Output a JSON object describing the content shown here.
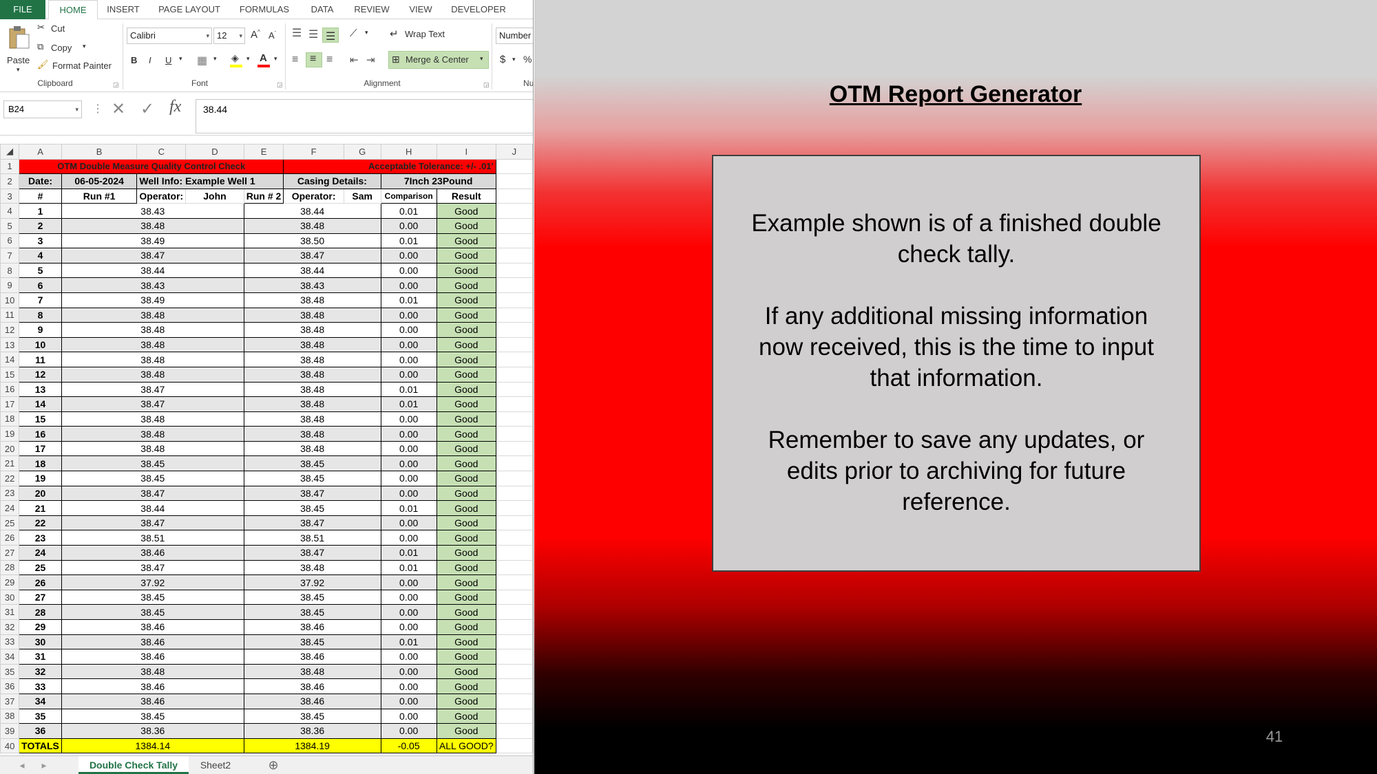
{
  "excel": {
    "ribbon_tabs": [
      "FILE",
      "HOME",
      "INSERT",
      "PAGE LAYOUT",
      "FORMULAS",
      "DATA",
      "REVIEW",
      "VIEW",
      "DEVELOPER"
    ],
    "clipboard": {
      "paste": "Paste",
      "cut": "Cut",
      "copy": "Copy",
      "format_painter": "Format Painter",
      "label": "Clipboard"
    },
    "font": {
      "name": "Calibri",
      "size": "12",
      "label": "Font",
      "bold": "B",
      "italic": "I",
      "underline": "U"
    },
    "alignment": {
      "wrap_text": "Wrap Text",
      "merge_center": "Merge & Center",
      "label": "Alignment"
    },
    "number": {
      "format": "Number",
      "label": "Nu",
      "currency": "$",
      "percent": "%"
    },
    "name_box": "B24",
    "formula_value": "38.44",
    "columns": [
      "A",
      "B",
      "C",
      "D",
      "E",
      "F",
      "G",
      "H",
      "I",
      "J"
    ],
    "row1": {
      "title": "OTM Double Measure Quality Control Check",
      "tolerance": "Acceptable Tolerance: +/- .01'"
    },
    "row2": {
      "date_label": "Date:",
      "date_value": "06-05-2024",
      "well_info": "Well Info: Example Well 1",
      "casing_label": "Casing Details:",
      "casing_value": "7Inch 23Pound"
    },
    "row3": {
      "num": "#",
      "run1": "Run #1",
      "operator1_label": "Operator:",
      "operator1": "John",
      "run2": "Run # 2",
      "operator2_label": "Operator:",
      "operator2": "Sam",
      "comparison": "Comparison",
      "result": "Result"
    },
    "rows": [
      [
        "1",
        "38.43",
        "38.44",
        "0.01",
        "Good"
      ],
      [
        "2",
        "38.48",
        "38.48",
        "0.00",
        "Good"
      ],
      [
        "3",
        "38.49",
        "38.50",
        "0.01",
        "Good"
      ],
      [
        "4",
        "38.47",
        "38.47",
        "0.00",
        "Good"
      ],
      [
        "5",
        "38.44",
        "38.44",
        "0.00",
        "Good"
      ],
      [
        "6",
        "38.43",
        "38.43",
        "0.00",
        "Good"
      ],
      [
        "7",
        "38.49",
        "38.48",
        "0.01",
        "Good"
      ],
      [
        "8",
        "38.48",
        "38.48",
        "0.00",
        "Good"
      ],
      [
        "9",
        "38.48",
        "38.48",
        "0.00",
        "Good"
      ],
      [
        "10",
        "38.48",
        "38.48",
        "0.00",
        "Good"
      ],
      [
        "11",
        "38.48",
        "38.48",
        "0.00",
        "Good"
      ],
      [
        "12",
        "38.48",
        "38.48",
        "0.00",
        "Good"
      ],
      [
        "13",
        "38.47",
        "38.48",
        "0.01",
        "Good"
      ],
      [
        "14",
        "38.47",
        "38.48",
        "0.01",
        "Good"
      ],
      [
        "15",
        "38.48",
        "38.48",
        "0.00",
        "Good"
      ],
      [
        "16",
        "38.48",
        "38.48",
        "0.00",
        "Good"
      ],
      [
        "17",
        "38.48",
        "38.48",
        "0.00",
        "Good"
      ],
      [
        "18",
        "38.45",
        "38.45",
        "0.00",
        "Good"
      ],
      [
        "19",
        "38.45",
        "38.45",
        "0.00",
        "Good"
      ],
      [
        "20",
        "38.47",
        "38.47",
        "0.00",
        "Good"
      ],
      [
        "21",
        "38.44",
        "38.45",
        "0.01",
        "Good"
      ],
      [
        "22",
        "38.47",
        "38.47",
        "0.00",
        "Good"
      ],
      [
        "23",
        "38.51",
        "38.51",
        "0.00",
        "Good"
      ],
      [
        "24",
        "38.46",
        "38.47",
        "0.01",
        "Good"
      ],
      [
        "25",
        "38.47",
        "38.48",
        "0.01",
        "Good"
      ],
      [
        "26",
        "37.92",
        "37.92",
        "0.00",
        "Good"
      ],
      [
        "27",
        "38.45",
        "38.45",
        "0.00",
        "Good"
      ],
      [
        "28",
        "38.45",
        "38.45",
        "0.00",
        "Good"
      ],
      [
        "29",
        "38.46",
        "38.46",
        "0.00",
        "Good"
      ],
      [
        "30",
        "38.46",
        "38.45",
        "0.01",
        "Good"
      ],
      [
        "31",
        "38.46",
        "38.46",
        "0.00",
        "Good"
      ],
      [
        "32",
        "38.48",
        "38.48",
        "0.00",
        "Good"
      ],
      [
        "33",
        "38.46",
        "38.46",
        "0.00",
        "Good"
      ],
      [
        "34",
        "38.46",
        "38.46",
        "0.00",
        "Good"
      ],
      [
        "35",
        "38.45",
        "38.45",
        "0.00",
        "Good"
      ],
      [
        "36",
        "38.36",
        "38.36",
        "0.00",
        "Good"
      ]
    ],
    "totals": {
      "label": "TOTALS",
      "run1": "1384.14",
      "run2": "1384.19",
      "comparison": "-0.05",
      "result": "ALL GOOD?"
    },
    "sheet_tabs": [
      "Double Check Tally",
      "Sheet2"
    ],
    "colors": {
      "excel_green": "#217346",
      "title_red": "#ff0000",
      "good_green": "#c6e0b4",
      "totals_yellow": "#ffff00"
    }
  },
  "slide": {
    "title": "OTM Report Generator",
    "paragraphs": [
      "Example shown is of a finished double check tally.",
      "If any additional missing information now received, this is the time to input that information.",
      "Remember to save any updates, or edits prior to archiving for future reference."
    ],
    "page_number": "41"
  }
}
